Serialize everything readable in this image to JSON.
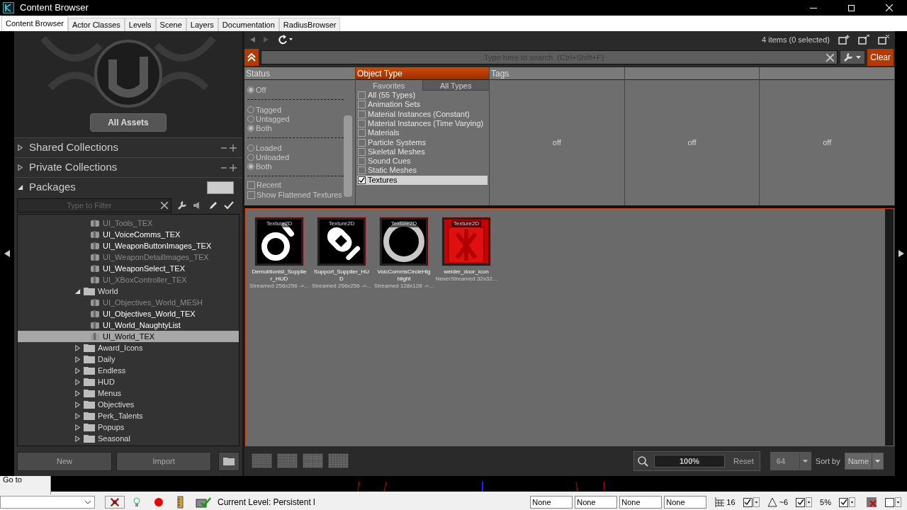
{
  "window": {
    "title": "Content Browser"
  },
  "tabs": [
    {
      "label": "Content Browser",
      "selected": true
    },
    {
      "label": "Actor Classes",
      "selected": false
    },
    {
      "label": "Levels",
      "selected": false
    },
    {
      "label": "Scene",
      "selected": false
    },
    {
      "label": "Layers",
      "selected": false
    },
    {
      "label": "Documentation",
      "selected": false
    },
    {
      "label": "RadiusBrowser",
      "selected": false
    }
  ],
  "left_panel": {
    "all_assets": "All Assets",
    "sections": [
      {
        "label": "Shared Collections",
        "expanded": false
      },
      {
        "label": "Private Collections",
        "expanded": false
      },
      {
        "label": "Packages",
        "expanded": true
      }
    ],
    "filter": {
      "placeholder": "Type to Filter"
    },
    "tree": [
      {
        "children": [
          {
            "kind": "package",
            "label": "UI_Tools_TEX",
            "loaded": false,
            "selected": false
          },
          {
            "kind": "package",
            "label": "UI_VoiceComms_TEX",
            "loaded": true,
            "selected": false
          },
          {
            "kind": "package",
            "label": "UI_WeaponButtonImages_TEX",
            "loaded": true,
            "selected": false
          },
          {
            "kind": "package",
            "label": "UI_WeaponDetailImages_TEX",
            "loaded": false,
            "selected": false
          },
          {
            "kind": "package",
            "label": "UI_WeaponSelect_TEX",
            "loaded": true,
            "selected": false
          },
          {
            "kind": "package",
            "label": "UI_XBoxController_TEX",
            "loaded": false,
            "selected": false
          }
        ]
      },
      {
        "kind": "folder",
        "label": "World",
        "expanded": true,
        "children": [
          {
            "kind": "package",
            "label": "UI_Objectives_World_MESH",
            "loaded": false,
            "selected": false
          },
          {
            "kind": "package",
            "label": "UI_Objectives_World_TEX",
            "loaded": true,
            "selected": false
          },
          {
            "kind": "package",
            "label": "UI_World_NaughtyList",
            "loaded": true,
            "selected": false
          },
          {
            "kind": "package",
            "label": "UI_World_TEX",
            "loaded": true,
            "selected": true
          }
        ]
      },
      {
        "kind": "folder",
        "label": "Award_Icons",
        "expanded": false
      },
      {
        "kind": "folder",
        "label": "Daily",
        "expanded": false
      },
      {
        "kind": "folder",
        "label": "Endless",
        "expanded": false
      },
      {
        "kind": "folder",
        "label": "HUD",
        "expanded": false
      },
      {
        "kind": "folder",
        "label": "Menus",
        "expanded": false
      },
      {
        "kind": "folder",
        "label": "Objectives",
        "expanded": false
      },
      {
        "kind": "folder",
        "label": "Perk_Talents",
        "expanded": false
      },
      {
        "kind": "folder",
        "label": "Popups",
        "expanded": false
      },
      {
        "kind": "folder",
        "label": "Seasonal",
        "expanded": false
      }
    ],
    "buttons": [
      "New",
      "Import"
    ]
  },
  "toolbar": {
    "item_count": "4 items (0 selected)"
  },
  "search": {
    "placeholder": "Type here to search  (Ctrl+Shift+F)",
    "clear": "Clear"
  },
  "filters": {
    "columns": [
      {
        "heading": "Status",
        "active": false
      },
      {
        "heading": "Object Type",
        "active": true
      },
      {
        "heading": "Tags",
        "active": false,
        "body": "off"
      },
      {
        "active": false,
        "body": "off"
      },
      {
        "active": false,
        "body": "off"
      }
    ],
    "status_groups": [
      [
        {
          "label": "Off",
          "selected": true
        }
      ],
      [
        {
          "label": "Tagged",
          "selected": false
        },
        {
          "label": "Untagged",
          "selected": false
        },
        {
          "label": "Both",
          "selected": true
        }
      ],
      [
        {
          "label": "Loaded",
          "selected": false
        },
        {
          "label": "Unloaded",
          "selected": false
        },
        {
          "label": "Both",
          "selected": true
        }
      ]
    ],
    "status_checks": [
      {
        "label": "Recent",
        "checked": false
      },
      {
        "label": "Show Flattened Textures",
        "checked": false
      }
    ],
    "type_tabs": [
      {
        "label": "Favorites",
        "selected": true
      },
      {
        "label": "All Types",
        "selected": false
      }
    ],
    "types": [
      {
        "label": "All (55 Types)",
        "checked": false
      },
      {
        "label": "Animation Sets",
        "checked": false
      },
      {
        "label": "Material Instances (Constant)",
        "checked": false
      },
      {
        "label": "Material Instances (Time Varying)",
        "checked": false
      },
      {
        "label": "Materials",
        "checked": false
      },
      {
        "label": "Particle Systems",
        "checked": false
      },
      {
        "label": "Skeletal Meshes",
        "checked": false
      },
      {
        "label": "Sound Cues",
        "checked": false
      },
      {
        "label": "Static Meshes",
        "checked": false
      },
      {
        "label": "Textures",
        "checked": true
      }
    ]
  },
  "assets": [
    {
      "kind": "ring",
      "type": "Texture2D",
      "name": "Demolitionist_Supplier_HUD",
      "info": "Streamed 256x256 ->..."
    },
    {
      "kind": "pill",
      "type": "Texture2D",
      "name": "Support_Supplier_HUD",
      "info": "Streamed 256x256 ->..."
    },
    {
      "kind": "circle",
      "type": "Texture2D",
      "name": "VoicCommsCircleHighlight",
      "info": "Streamed 128x128 ->..."
    },
    {
      "kind": "door",
      "type": "Texture2D",
      "name": "welder_door_icon",
      "info": "NeverStreamed 32x32..."
    }
  ],
  "bottom_bar": {
    "zoom": "100%",
    "reset": "Reset",
    "size": "64",
    "sort_label": "Sort by",
    "sort": "Name"
  },
  "status_bar": {
    "goto": "Go to",
    "level_label": "Current Level:",
    "level": "Persistent l",
    "fields": [
      "None",
      "None",
      "None",
      "None"
    ],
    "snaps": [
      {
        "kind": "grid",
        "reading": "16",
        "checked": true
      },
      {
        "kind": "angle",
        "reading": "~6",
        "checked": true
      },
      {
        "kind": "scale",
        "reading": "5%",
        "checked": true
      }
    ],
    "last_check": {
      "checked": false
    }
  }
}
